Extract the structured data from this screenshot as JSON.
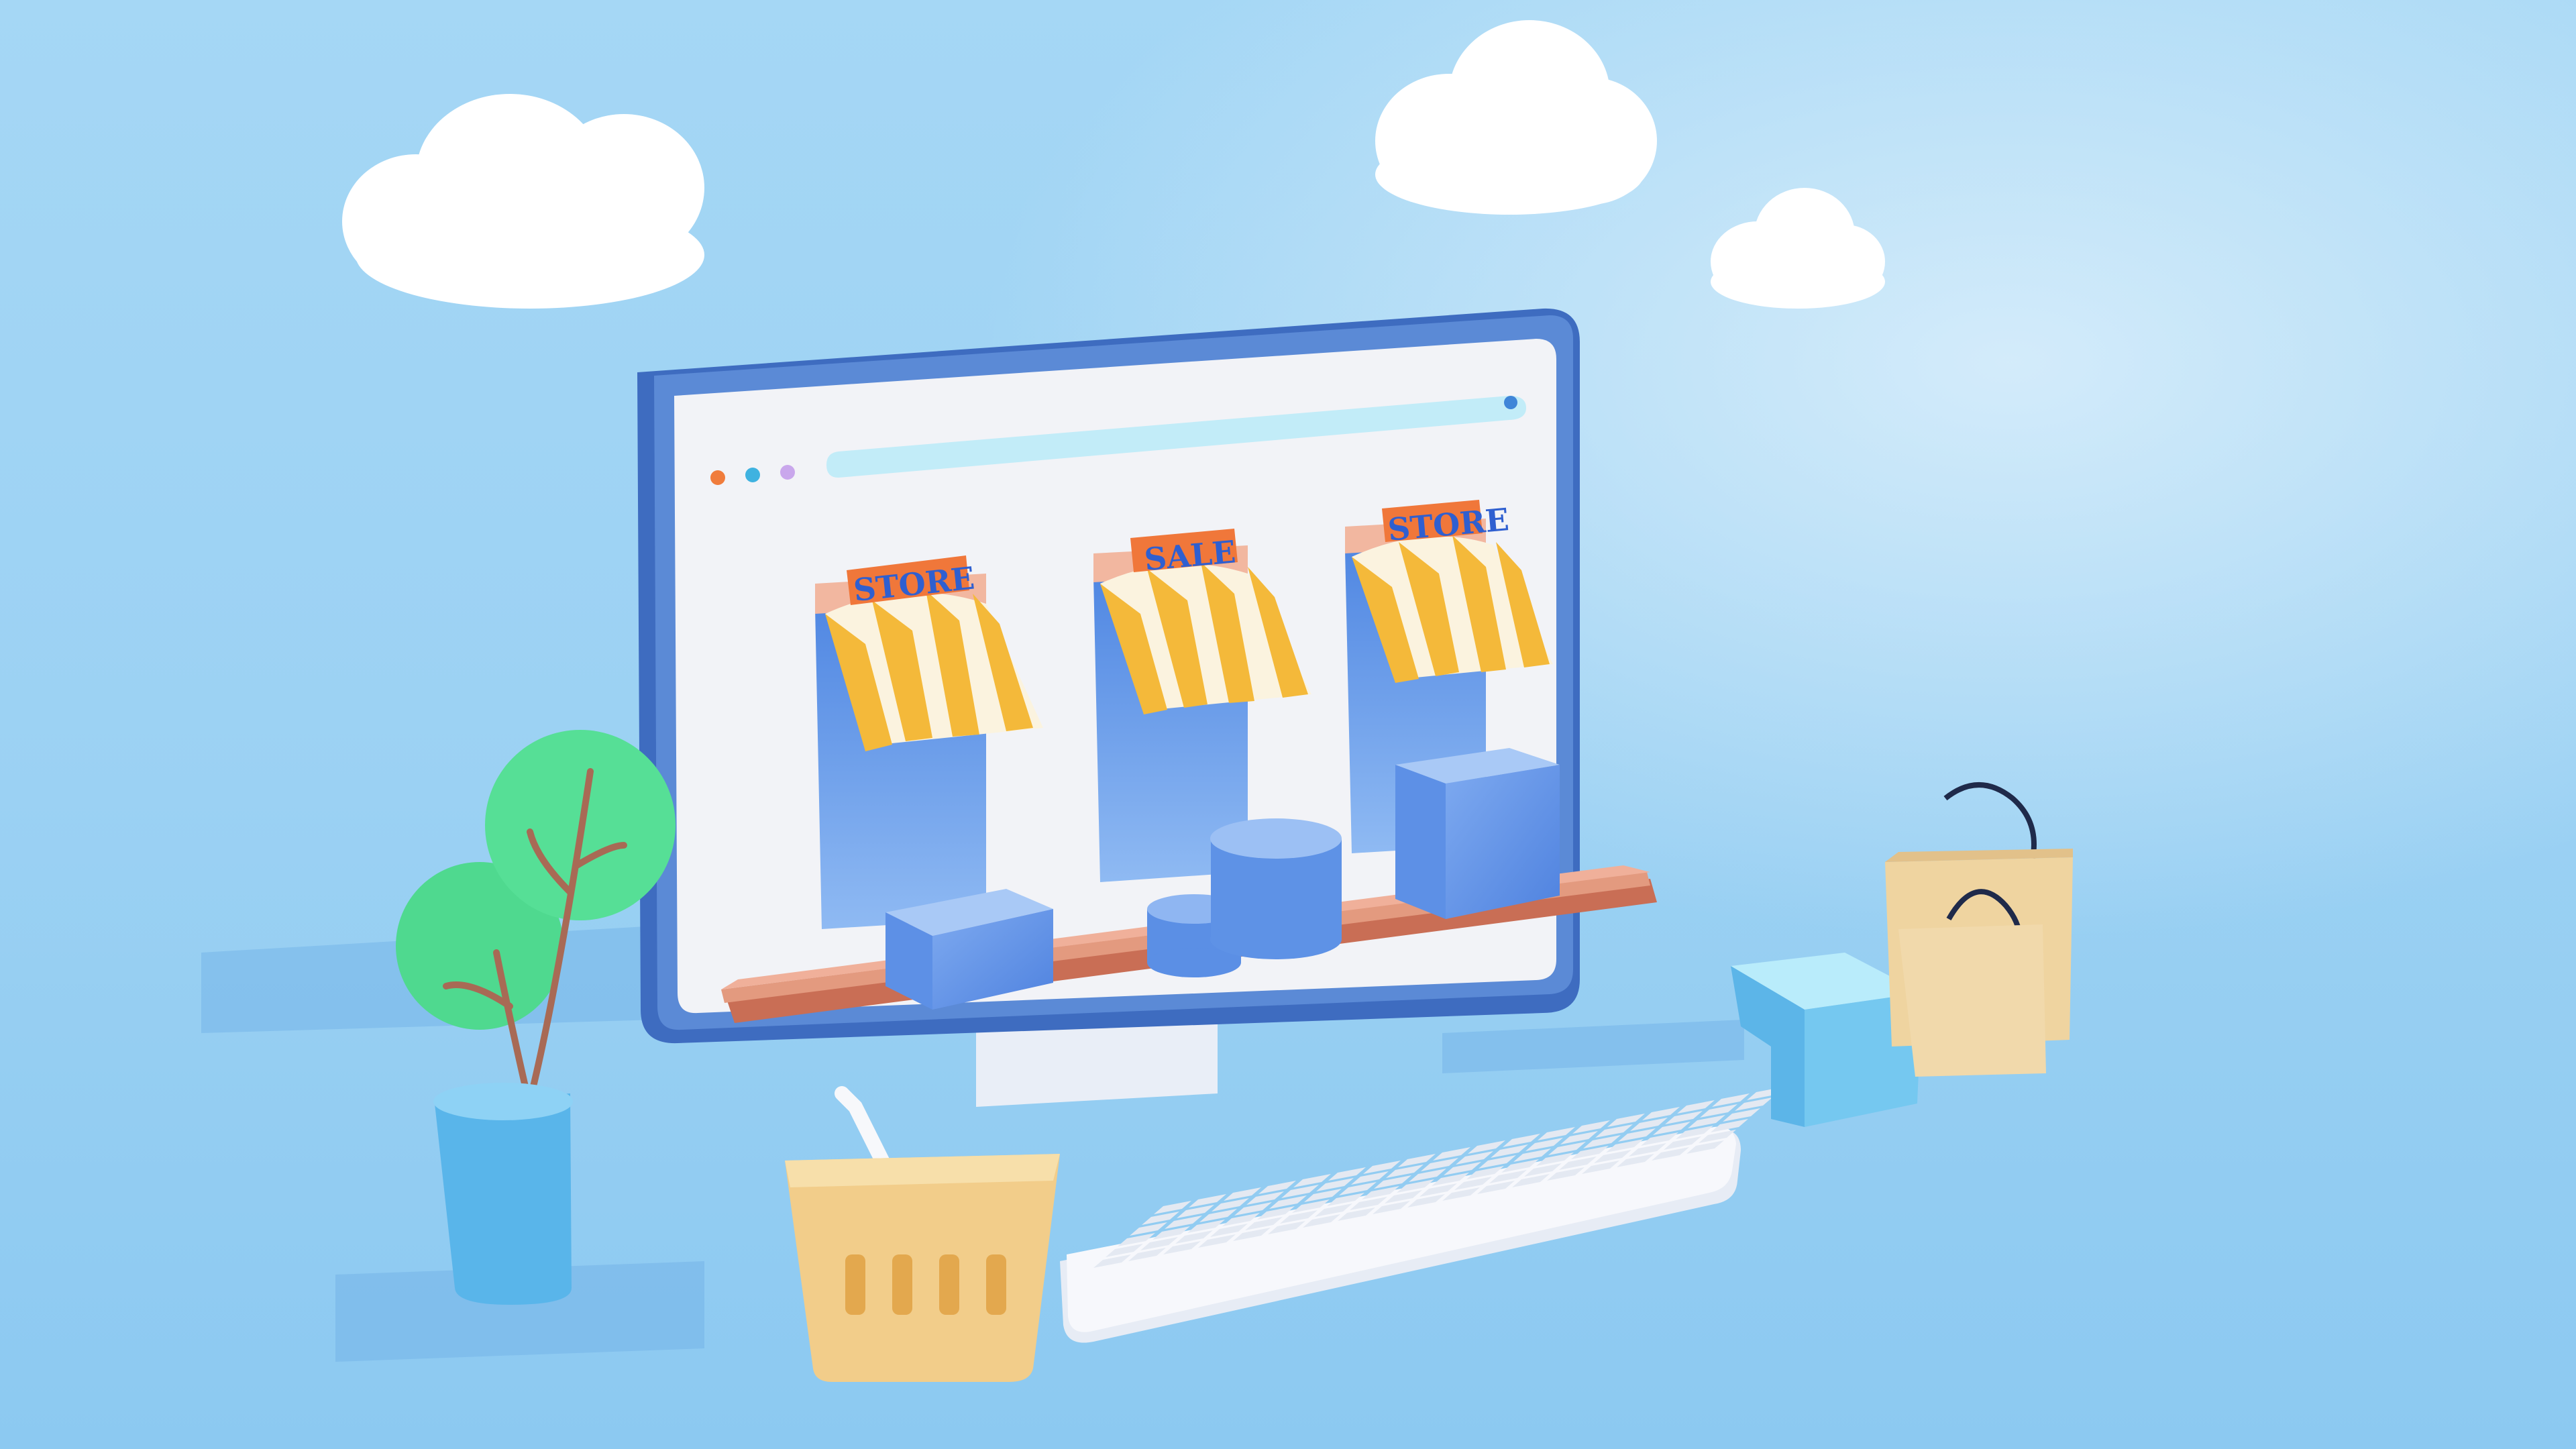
{
  "scene": {
    "signs": [
      {
        "label": "STORE"
      },
      {
        "label": "SALE"
      },
      {
        "label": "STORE"
      }
    ]
  },
  "colors": {
    "sky_top": "#9fd4f4",
    "sky_bottom": "#8ccaf2",
    "monitor_frame": "#4f7fd0",
    "screen": "#f3f4f8",
    "address_bar": "#bfeaf7",
    "awning_yellow": "#f4b93a",
    "awning_white": "#fbf3df",
    "sign_orange": "#f0773a",
    "sign_text": "#2f5fd0",
    "shelf": "#d8826a",
    "store_panel": "#5f94e8",
    "plant_leaf": "#4fd98f",
    "pot": "#5eb8ec",
    "basket": "#f2cd8a",
    "bag": "#efd4a0",
    "keyboard": "#f4f6fb",
    "cloud": "#ffffff"
  },
  "icons": [
    "cloud-icon",
    "shopping-basket-icon",
    "shopping-bag-icon",
    "gift-box-icon",
    "potted-plant-icon",
    "keyboard-icon",
    "desktop-monitor-icon"
  ]
}
